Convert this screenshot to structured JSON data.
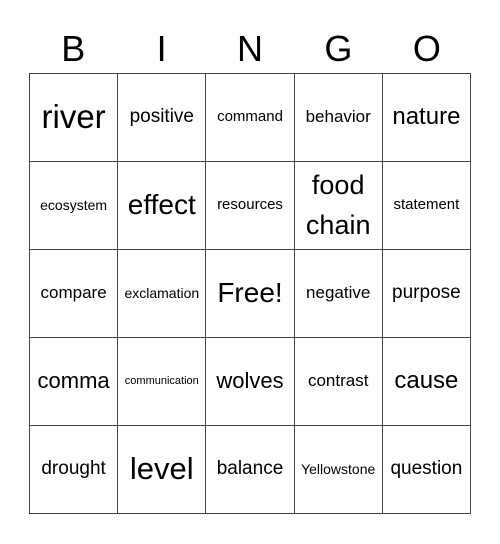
{
  "header": {
    "letters": [
      "B",
      "I",
      "N",
      "G",
      "O"
    ]
  },
  "cells": [
    [
      "river",
      "positive",
      "command",
      "behavior",
      "nature"
    ],
    [
      "ecosystem",
      "effect",
      "resources",
      "food chain",
      "statement"
    ],
    [
      "compare",
      "exclamation",
      "Free!",
      "negative",
      "purpose"
    ],
    [
      "comma",
      "communication",
      "wolves",
      "contrast",
      "cause"
    ],
    [
      "drought",
      "level",
      "balance",
      "Yellowstone",
      "question"
    ]
  ]
}
